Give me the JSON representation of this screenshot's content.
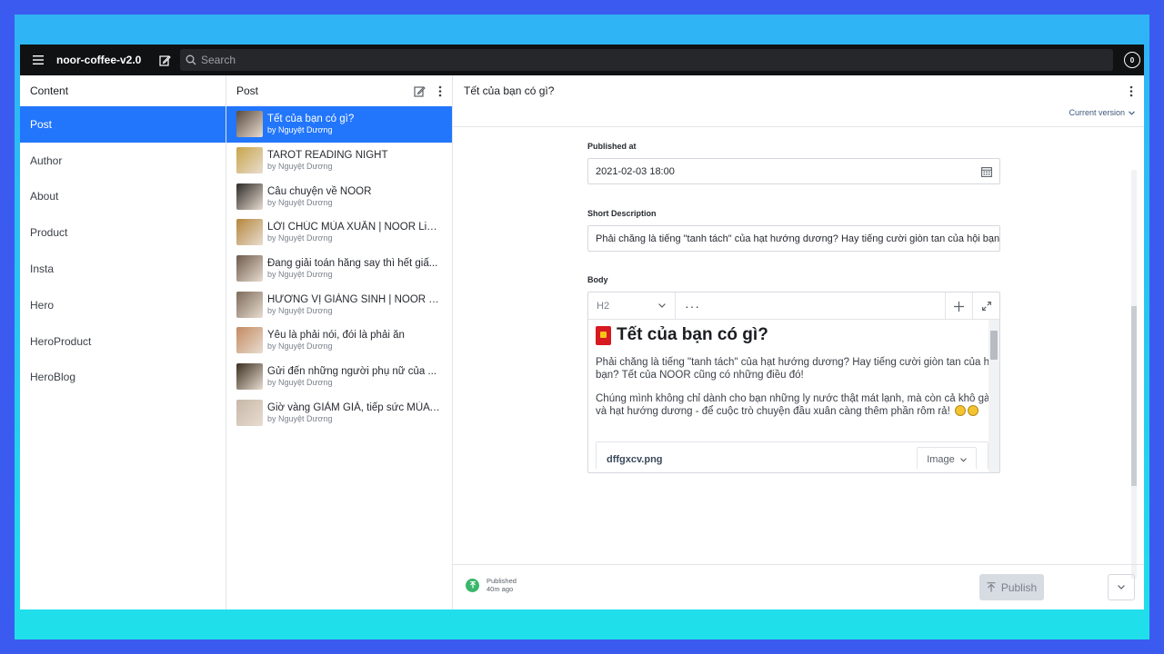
{
  "topbar": {
    "app_title": "noor-coffee-v2.0",
    "search_placeholder": "Search",
    "avatar_count": "0"
  },
  "content_pane": {
    "title": "Content",
    "items": [
      "Post",
      "Author",
      "About",
      "Product",
      "Insta",
      "Hero",
      "HeroProduct",
      "HeroBlog"
    ],
    "active_index": 0
  },
  "post_pane": {
    "title": "Post",
    "items": [
      {
        "title": "Tết của bạn có gì?",
        "by": "by Nguyệt Dương",
        "thumb_color": "#5b4a3f"
      },
      {
        "title": "TAROT READING NIGHT",
        "by": "by Nguyệt Dương",
        "thumb_color": "#c9a449"
      },
      {
        "title": "Câu chuyện về NOOR",
        "by": "by Nguyệt Dương",
        "thumb_color": "#2e2a28"
      },
      {
        "title": "LỜI CHÚC MÙA XUÂN | NOOR Limi...",
        "by": "by Nguyệt Dương",
        "thumb_color": "#b5863c"
      },
      {
        "title": "Đang giải toán hăng say thì hết giấ...",
        "by": "by Nguyệt Dương",
        "thumb_color": "#6e5a4c"
      },
      {
        "title": "HƯƠNG VỊ GIÁNG SINH | NOOR Li...",
        "by": "by Nguyệt Dương",
        "thumb_color": "#7d6b5a"
      },
      {
        "title": "Yêu là phải nói, đói là phải ăn",
        "by": "by Nguyệt Dương",
        "thumb_color": "#c48a62"
      },
      {
        "title": "Gửi đến những người phụ nữ của ...",
        "by": "by Nguyệt Dương",
        "thumb_color": "#3b2f22"
      },
      {
        "title": "Giờ vàng GIẢM GIÁ, tiếp sức MÙA ...",
        "by": "by Nguyệt Dương",
        "thumb_color": "#c7b7a8"
      }
    ]
  },
  "document": {
    "title": "Tết của bạn có gì?",
    "version_label": "Current version",
    "published_at_label": "Published at",
    "published_at_value": "2021-02-03 18:00",
    "short_description_label": "Short Description",
    "short_description_value": "Phải chăng là tiếng \"tanh tách\" của hạt hướng dương? Hay tiếng cười giòn tan của hội bạn? Tết",
    "body_label": "Body",
    "editor": {
      "style_value": "H2",
      "heading": "Tết của bạn có gì?",
      "paragraph1_line1": "Phải chăng là tiếng \"tanh tách\" của hạt hướng dương? Hay tiếng cười giòn tan của hội",
      "paragraph1_line2": "bạn? Tết của NOOR cũng có những điều đó!",
      "paragraph2_line1": "Chúng mình không chỉ dành cho bạn những ly nước thật mát lạnh, mà còn cả khô gà",
      "paragraph2_line2": "và hạt hướng dương - để cuộc trò chuyện đầu xuân càng thêm phần rôm rả!",
      "image_name": "dffgxcv.png",
      "image_type": "Image"
    }
  },
  "footer": {
    "status_label": "Published",
    "status_time": "40m ago",
    "publish_label": "Publish"
  }
}
